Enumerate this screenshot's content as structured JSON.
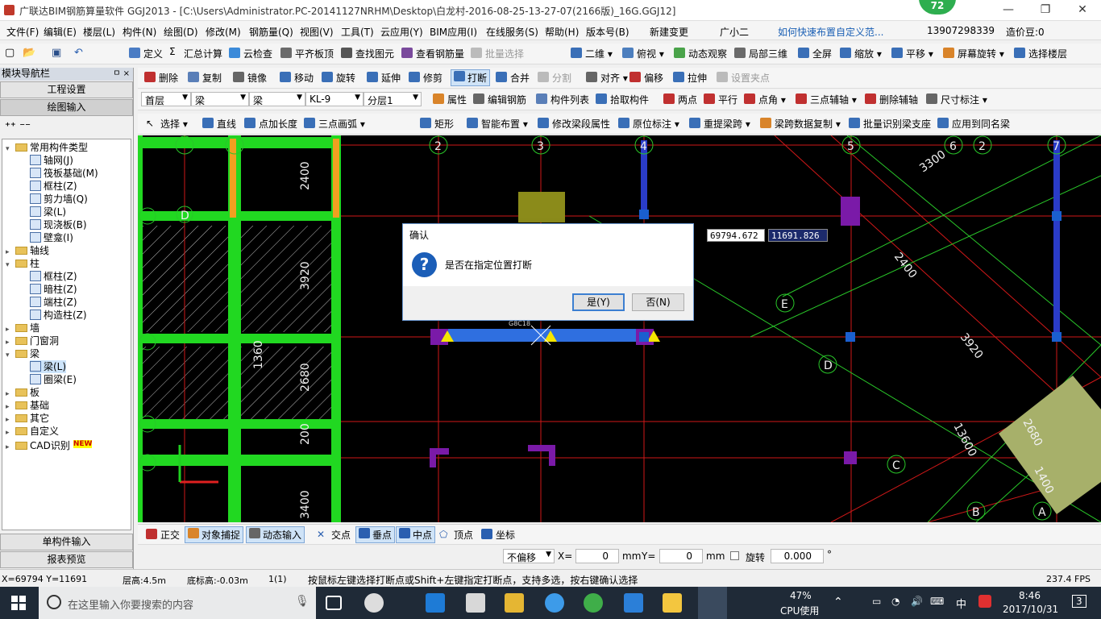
{
  "window": {
    "title": "广联达BIM钢筋算量软件 GGJ2013 - [C:\\Users\\Administrator.PC-20141127NRHM\\Desktop\\白龙村-2016-08-25-13-27-07(2166版)_16G.GGJ12]",
    "badge": "72",
    "min": "—",
    "restore": "❐",
    "close": "✕"
  },
  "menu": [
    "文件(F)",
    "编辑(E)",
    "楼层(L)",
    "构件(N)",
    "绘图(D)",
    "修改(M)",
    "钢筋量(Q)",
    "视图(V)",
    "工具(T)",
    "云应用(Y)",
    "BIM应用(I)",
    "在线服务(S)",
    "帮助(H)",
    "版本号(B)",
    "新建变更",
    "广小二",
    "如何快速布置自定义范...",
    "13907298339",
    "造价豆:0"
  ],
  "toolbar1": [
    "定义",
    "汇总计算",
    "云检查",
    "平齐板顶",
    "查找图元",
    "查看钢筋量",
    "批量选择",
    "二维",
    "俯视",
    "动态观察",
    "局部三维",
    "全屏",
    "缩放",
    "平移",
    "屏幕旋转",
    "选择楼层"
  ],
  "toolbar2": [
    "删除",
    "复制",
    "镜像",
    "移动",
    "旋转",
    "延伸",
    "修剪",
    "打断",
    "合并",
    "分割",
    "对齐",
    "偏移",
    "拉伸",
    "设置夹点"
  ],
  "selectors": {
    "floor": "首层",
    "type1": "梁",
    "type2": "梁",
    "component": "KL-9",
    "layer": "分层1"
  },
  "toolbar3": [
    "属性",
    "编辑钢筋",
    "构件列表",
    "拾取构件",
    "两点",
    "平行",
    "点角",
    "三点辅轴",
    "删除辅轴",
    "尺寸标注"
  ],
  "toolbar4": [
    "选择",
    "直线",
    "点加长度",
    "三点画弧",
    "矩形",
    "智能布置",
    "修改梁段属性",
    "原位标注",
    "重提梁跨",
    "梁跨数据复制",
    "批量识别梁支座",
    "应用到同名梁"
  ],
  "left_panel": {
    "title": "模块导航栏",
    "pin": "ㅁ ×",
    "tab_project": "工程设置",
    "tab_draw": "绘图输入",
    "tree": [
      {
        "label": "常用构件类型",
        "kind": "folder",
        "open": true
      },
      {
        "label": "轴网(J)",
        "kind": "item"
      },
      {
        "label": "筏板基础(M)",
        "kind": "item"
      },
      {
        "label": "框柱(Z)",
        "kind": "item"
      },
      {
        "label": "剪力墙(Q)",
        "kind": "item"
      },
      {
        "label": "梁(L)",
        "kind": "item"
      },
      {
        "label": "现浇板(B)",
        "kind": "item"
      },
      {
        "label": "壁龛(I)",
        "kind": "item"
      },
      {
        "label": "轴线",
        "kind": "folder",
        "open": false
      },
      {
        "label": "柱",
        "kind": "folder",
        "open": true
      },
      {
        "label": "框柱(Z)",
        "kind": "item"
      },
      {
        "label": "暗柱(Z)",
        "kind": "item"
      },
      {
        "label": "端柱(Z)",
        "kind": "item"
      },
      {
        "label": "构造柱(Z)",
        "kind": "item"
      },
      {
        "label": "墙",
        "kind": "folder",
        "open": false
      },
      {
        "label": "门窗洞",
        "kind": "folder",
        "open": false
      },
      {
        "label": "梁",
        "kind": "folder",
        "open": true
      },
      {
        "label": "梁(L)",
        "kind": "item",
        "selected": true
      },
      {
        "label": "圈梁(E)",
        "kind": "item"
      },
      {
        "label": "板",
        "kind": "folder",
        "open": false
      },
      {
        "label": "基础",
        "kind": "folder",
        "open": false
      },
      {
        "label": "其它",
        "kind": "folder",
        "open": false
      },
      {
        "label": "自定义",
        "kind": "folder",
        "open": false
      },
      {
        "label": "CAD识别",
        "kind": "folder",
        "open": false,
        "new": "NEW"
      }
    ],
    "tab_single": "单构件输入",
    "tab_report": "报表预览"
  },
  "canvas": {
    "axis_labels": [
      "2",
      "3",
      "4",
      "5",
      "6",
      "2",
      "7",
      "D",
      "E",
      "D",
      "C",
      "B",
      "A"
    ],
    "dims": [
      "2400",
      "3920",
      "2680",
      "1360",
      "200",
      "3400",
      "3300",
      "2400",
      "3920",
      "13600",
      "2680",
      "1400"
    ],
    "beam_label": "G8C18"
  },
  "dialog": {
    "title": "确认",
    "message": "是否在指定位置打断",
    "yes": "是(Y)",
    "no": "否(N)"
  },
  "coords": {
    "x": "69794.672",
    "y": "11691.826"
  },
  "snap_bar": [
    "正交",
    "对象捕捉",
    "动态输入",
    "交点",
    "垂点",
    "中点",
    "顶点",
    "坐标"
  ],
  "offset_bar": {
    "mode": "不偏移",
    "x_label": "X=",
    "x": "0",
    "y_label": "Y=",
    "y": "0",
    "unit": "mm",
    "rotate": "旋转",
    "angle": "0.000",
    "deg": "°"
  },
  "status": {
    "xy": "X=69794 Y=11691",
    "floor_h": "层高:4.5m",
    "base_h": "底标高:-0.03m",
    "count": "1(1)",
    "hint": "按鼠标左键选择打断点或Shift+左键指定打断点，支持多选，按右键确认选择",
    "fps": "237.4 FPS"
  },
  "taskbar": {
    "search": "在这里输入你要搜索的内容",
    "cpu": "47%",
    "cpu_label": "CPU使用",
    "ime": "中",
    "time": "8:46",
    "date": "2017/10/31",
    "notif": "3"
  }
}
